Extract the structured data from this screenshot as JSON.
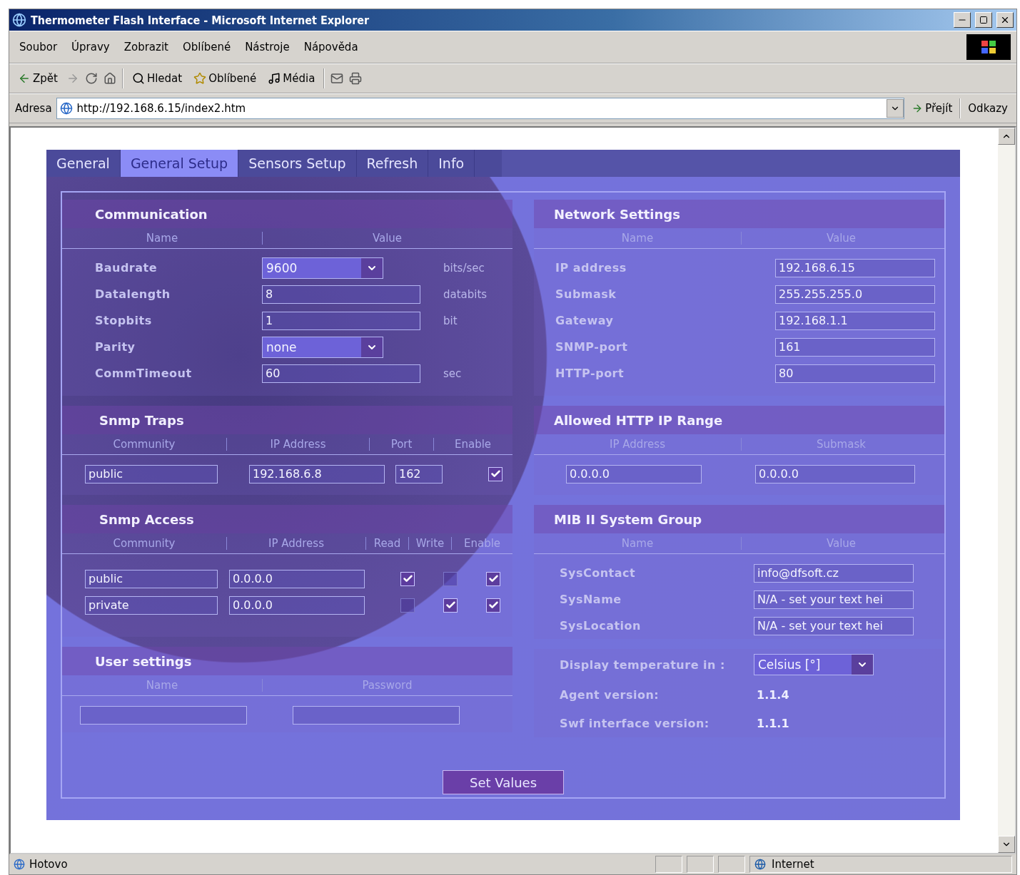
{
  "window": {
    "title": "Thermometer Flash Interface - Microsoft Internet Explorer"
  },
  "menu": [
    "Soubor",
    "Úpravy",
    "Zobrazit",
    "Oblíbené",
    "Nástroje",
    "Nápověda"
  ],
  "toolbar": [
    {
      "kind": "back",
      "label": "Zpět"
    },
    {
      "kind": "search",
      "label": "Hledat"
    },
    {
      "kind": "favorites",
      "label": "Oblíbené"
    },
    {
      "kind": "media",
      "label": "Média"
    }
  ],
  "address": {
    "label": "Adresa",
    "url": "http://192.168.6.15/index2.htm",
    "go": "Přejít",
    "links": "Odkazy"
  },
  "tabs": [
    {
      "label": "General",
      "selected": false
    },
    {
      "label": "General Setup",
      "selected": true
    },
    {
      "label": "Sensors Setup",
      "selected": false
    },
    {
      "label": "Refresh",
      "selected": false
    },
    {
      "label": "Info",
      "selected": false
    }
  ],
  "communication": {
    "title": "Communication",
    "columns": [
      "Name",
      "Value"
    ],
    "rows": [
      {
        "name": "Baudrate",
        "kind": "select",
        "value": "9600",
        "unit": "bits/sec"
      },
      {
        "name": "Datalength",
        "kind": "text",
        "value": "8",
        "unit": "databits"
      },
      {
        "name": "Stopbits",
        "kind": "text",
        "value": "1",
        "unit": "bit"
      },
      {
        "name": "Parity",
        "kind": "select",
        "value": "none"
      },
      {
        "name": "CommTimeout",
        "kind": "text",
        "value": "60",
        "unit": "sec"
      }
    ]
  },
  "snmp_traps": {
    "title": "Snmp Traps",
    "columns": [
      "Community",
      "IP Address",
      "Port",
      "Enable"
    ],
    "rows": [
      {
        "community": "public",
        "ip": "192.168.6.8",
        "port": "162",
        "enable": true
      }
    ]
  },
  "snmp_access": {
    "title": "Snmp Access",
    "columns": [
      "Community",
      "IP Address",
      "Read",
      "Write",
      "Enable"
    ],
    "rows": [
      {
        "community": "public",
        "ip": "0.0.0.0",
        "read": true,
        "write": false,
        "enable": true
      },
      {
        "community": "private",
        "ip": "0.0.0.0",
        "read": false,
        "write": true,
        "enable": true
      }
    ]
  },
  "user_settings": {
    "title": "User settings",
    "columns": [
      "Name",
      "Password"
    ]
  },
  "network": {
    "title": "Network Settings",
    "columns": [
      "Name",
      "Value"
    ],
    "rows": [
      {
        "name": "IP address",
        "value": "192.168.6.15"
      },
      {
        "name": "Submask",
        "value": "255.255.255.0"
      },
      {
        "name": "Gateway",
        "value": "192.168.1.1"
      },
      {
        "name": "SNMP-port",
        "value": "161"
      },
      {
        "name": "HTTP-port",
        "value": "80"
      }
    ]
  },
  "allowed_range": {
    "title": "Allowed HTTP IP Range",
    "columns": [
      "IP Address",
      "Submask"
    ],
    "rows": [
      {
        "ip": "0.0.0.0",
        "submask": "0.0.0.0"
      }
    ]
  },
  "mib": {
    "title": "MIB II System Group",
    "columns": [
      "Name",
      "Value"
    ],
    "rows": [
      {
        "name": "SysContact",
        "value": "info@dfsoft.cz"
      },
      {
        "name": "SysName",
        "value": "N/A - set your text hei"
      },
      {
        "name": "SysLocation",
        "value": "N/A - set your text hei"
      }
    ]
  },
  "info": {
    "temperature": {
      "label": "Display temperature in :",
      "value": "Celsius [°]"
    },
    "rows": [
      {
        "label": "Agent version:",
        "value": "1.1.4"
      },
      {
        "label": "Swf interface version:",
        "value": "1.1.1"
      }
    ]
  },
  "submit": "Set Values",
  "status_bar": {
    "text": "Hotovo",
    "zone": "Internet"
  }
}
